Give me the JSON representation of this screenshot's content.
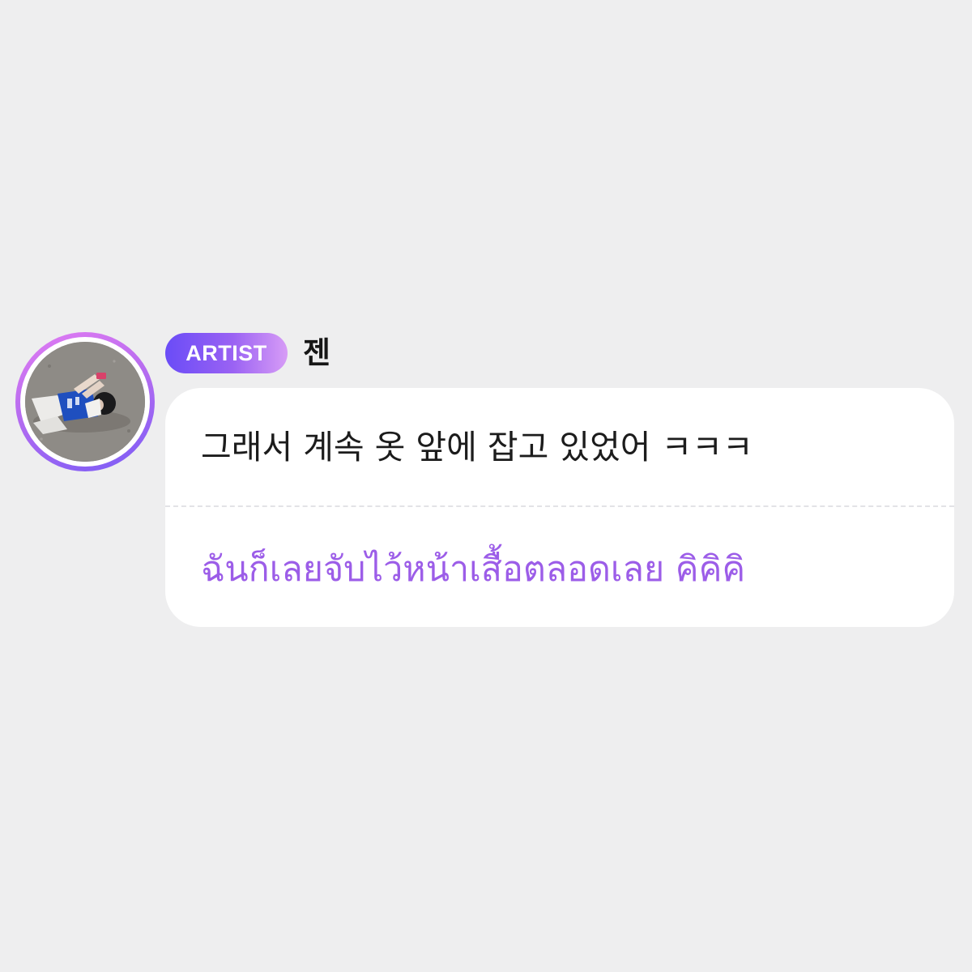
{
  "message": {
    "badge_label": "ARTIST",
    "author_name": "젠",
    "original_text": "그래서 계속 옷 앞에 잡고 있었어 ㅋㅋㅋ",
    "translated_text": "ฉันก็เลยจับไว้หน้าเสื้อตลอดเลย คิคิคิ"
  },
  "colors": {
    "page_background": "#eeeeef",
    "bubble_background": "#ffffff",
    "badge_gradient_start": "#6a4cf7",
    "badge_gradient_end": "#d79cf6",
    "translated_text": "#9c5de8",
    "original_text": "#1c1c1c"
  }
}
